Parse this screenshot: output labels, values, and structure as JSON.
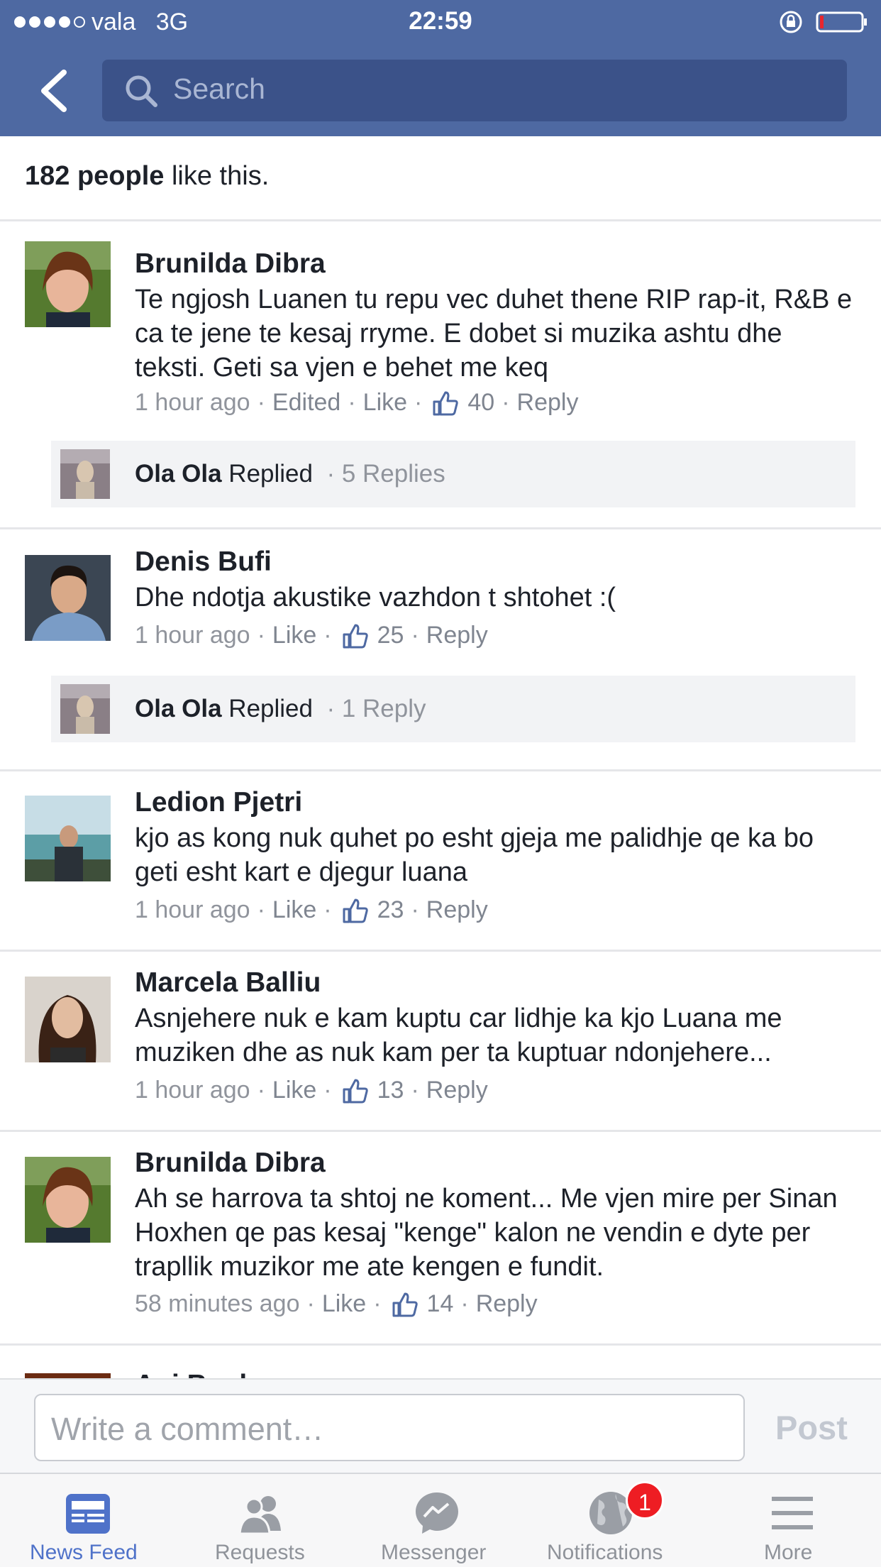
{
  "status_bar": {
    "carrier": "vala",
    "network": "3G",
    "time": "22:59"
  },
  "search": {
    "placeholder": "Search"
  },
  "likes": {
    "count_text": "182 people",
    "suffix": " like this."
  },
  "comments": [
    {
      "author": "Brunilda Dibra",
      "text": "Te ngjosh Luanen tu repu vec duhet thene RIP rap-it, R&B e ca te jene te kesaj rryme. E dobet si muzika ashtu dhe teksti. Geti sa vjen e behet me keq",
      "time": "1 hour ago",
      "edited": "Edited",
      "like": "Like",
      "like_count": "40",
      "reply": "Reply",
      "reply_row": {
        "name": "Ola Ola",
        "action": "Replied",
        "count": "· 5 Replies"
      }
    },
    {
      "author": "Denis Bufi",
      "text": "Dhe ndotja akustike vazhdon t shtohet :(",
      "time": "1 hour ago",
      "like": "Like",
      "like_count": "25",
      "reply": "Reply",
      "reply_row": {
        "name": "Ola Ola",
        "action": "Replied",
        "count": "· 1 Reply"
      }
    },
    {
      "author": "Ledion Pjetri",
      "text": "kjo as kong nuk quhet po esht gjeja me palidhje qe ka bo geti esht kart e djegur luana",
      "time": "1 hour ago",
      "like": "Like",
      "like_count": "23",
      "reply": "Reply"
    },
    {
      "author": "Marcela Balliu",
      "text": "Asnjehere nuk e kam kuptu car lidhje ka kjo Luana me muziken dhe as nuk kam per ta kuptuar ndonjehere...",
      "time": "1 hour ago",
      "like": "Like",
      "like_count": "13",
      "reply": "Reply"
    },
    {
      "author": "Brunilda Dibra",
      "text": "Ah se harrova ta shtoj ne koment... Me vjen mire per Sinan Hoxhen qe pas kesaj \"kenge\" kalon ne vendin e dyte per trapllik muzikor me ate kengen e fundit.",
      "time": "58 minutes ago",
      "like": "Like",
      "like_count": "14",
      "reply": "Reply"
    }
  ],
  "partial_comment": {
    "author": "Agi Bosha"
  },
  "composer": {
    "placeholder": "Write a comment…",
    "post_label": "Post"
  },
  "tabs": [
    {
      "label": "News Feed",
      "icon": "news-feed-icon",
      "active": true
    },
    {
      "label": "Requests",
      "icon": "friend-requests-icon"
    },
    {
      "label": "Messenger",
      "icon": "messenger-icon"
    },
    {
      "label": "Notifications",
      "icon": "globe-icon",
      "badge": "1"
    },
    {
      "label": "More",
      "icon": "menu-icon"
    }
  ],
  "colors": {
    "brand": "#4e69a2",
    "search_field": "#3b5289",
    "active_tab": "#4f72c9",
    "badge": "#ee1d23"
  }
}
